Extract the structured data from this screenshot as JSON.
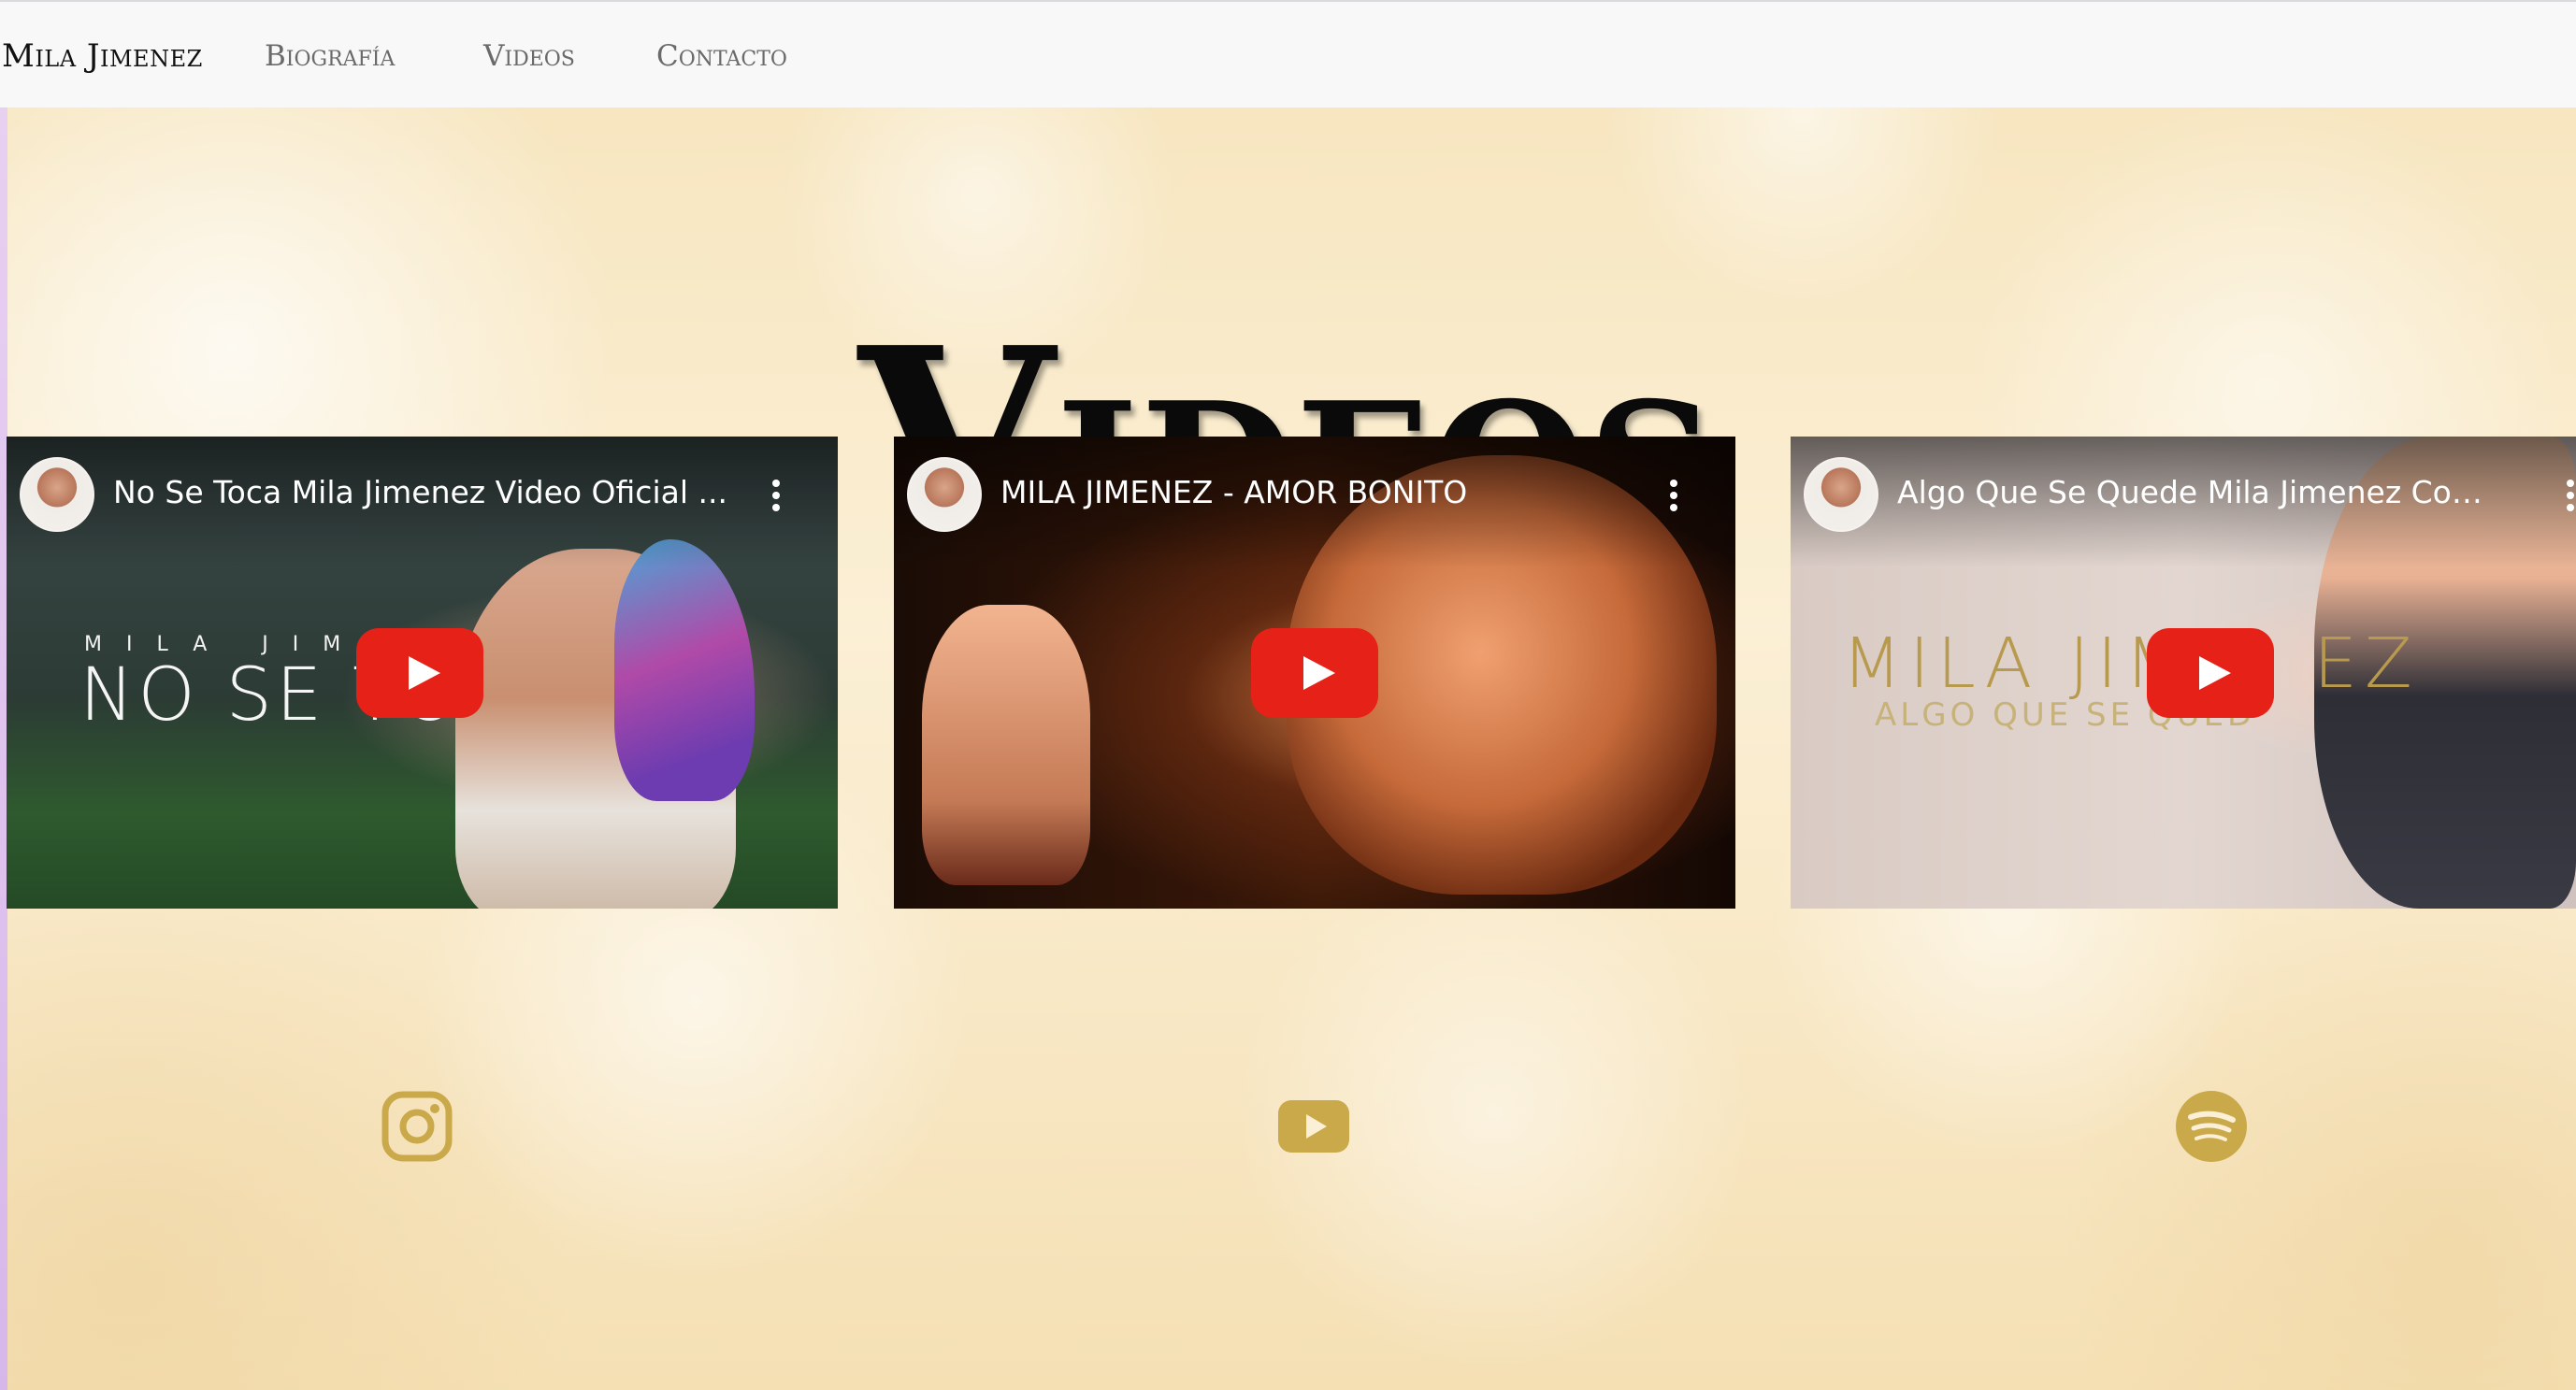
{
  "brand": {
    "name": "Mila Jimenez"
  },
  "nav": {
    "links": [
      {
        "label": "Biografía"
      },
      {
        "label": "Videos"
      },
      {
        "label": "Contacto"
      }
    ]
  },
  "page": {
    "title": "Videos"
  },
  "videos": [
    {
      "title": "No Se Toca Mila Jimenez Video Oficial ...",
      "overlay_small": "MILA JIME",
      "overlay_big": "NO SE TO"
    },
    {
      "title": "MILA JIMENEZ - AMOR BONITO"
    },
    {
      "title": "Algo Que Se Quede Mila Jimenez Cover",
      "overlay_big": "MILA JIM",
      "overlay_big_tail": "EZ",
      "overlay_small": "ALGO QUE SE QUED"
    }
  ],
  "social": {
    "icons": [
      "instagram-icon",
      "youtube-icon",
      "spotify-icon"
    ],
    "color": "#c9a94a"
  },
  "colors": {
    "play_button": "#e62117",
    "navbar_bg": "#f8f8f9"
  }
}
